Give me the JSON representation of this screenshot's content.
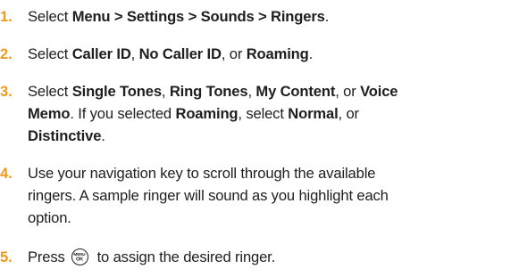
{
  "steps": [
    {
      "number": "1.",
      "segments": [
        {
          "t": "Select ",
          "b": false
        },
        {
          "t": "Menu > Settings > Sounds > Ringers",
          "b": true
        },
        {
          "t": ".",
          "b": false
        }
      ]
    },
    {
      "number": "2.",
      "segments": [
        {
          "t": "Select ",
          "b": false
        },
        {
          "t": "Caller ID",
          "b": true
        },
        {
          "t": ", ",
          "b": false
        },
        {
          "t": "No Caller ID",
          "b": true
        },
        {
          "t": ", or ",
          "b": false
        },
        {
          "t": "Roaming",
          "b": true
        },
        {
          "t": ".",
          "b": false
        }
      ]
    },
    {
      "number": "3.",
      "lines": [
        [
          {
            "t": "Select ",
            "b": false
          },
          {
            "t": "Single Tones",
            "b": true
          },
          {
            "t": ", ",
            "b": false
          },
          {
            "t": "Ring Tones",
            "b": true
          },
          {
            "t": ", ",
            "b": false
          },
          {
            "t": "My Content",
            "b": true
          },
          {
            "t": ", or ",
            "b": false
          },
          {
            "t": "Voice",
            "b": true
          }
        ],
        [
          {
            "t": "Memo",
            "b": true
          },
          {
            "t": ". If you selected ",
            "b": false
          },
          {
            "t": "Roaming",
            "b": true
          },
          {
            "t": ", select ",
            "b": false
          },
          {
            "t": "Normal",
            "b": true
          },
          {
            "t": ", or",
            "b": false
          }
        ],
        [
          {
            "t": "Distinctive",
            "b": true
          },
          {
            "t": ".",
            "b": false
          }
        ]
      ]
    },
    {
      "number": "4.",
      "lines": [
        "Use your navigation key to scroll through the available",
        "ringers. A sample ringer will sound as you highlight each",
        "option."
      ]
    },
    {
      "number": "5.",
      "before": "Press ",
      "icon": "menu-ok-key-icon",
      "icon_text_top": "MENU",
      "icon_text_bottom": "OK",
      "after": " to assign the desired ringer."
    }
  ],
  "colors": {
    "number": "#f29a1e",
    "text": "#1e1e1e"
  }
}
